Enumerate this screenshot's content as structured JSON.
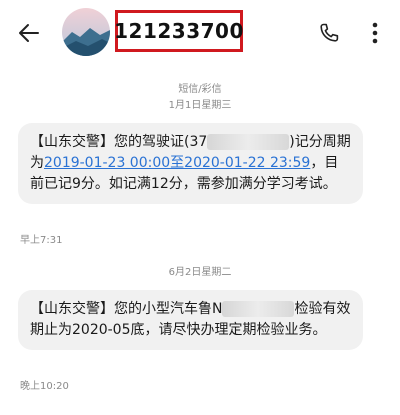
{
  "header": {
    "title": "121233700"
  },
  "thread": {
    "channel": "短信/彩信",
    "date_1": "1月1日星期三",
    "date_2": "6月2日星期二"
  },
  "messages": [
    {
      "sender_tag": "【山东交警】",
      "part_a": "您的驾驶证(",
      "redacted_prefix": "37",
      "part_b": ")记分周期为",
      "link_text": "2019-01-23 00:00至2020-01-22 23:59",
      "part_c": "，目前已记9分。如记满12分，需参加满分学习考试。",
      "time": "早上7:31"
    },
    {
      "sender_tag": "【山东交警】",
      "part_a": "您的小型汽车鲁N",
      "part_b": "检验有效期止为2020-05底，请尽快办理定期检验业务。",
      "time": "晚上10:20"
    }
  ],
  "colors": {
    "highlight_border": "#d0191f",
    "link": "#2a72d4",
    "bubble_bg": "#f1f1f1",
    "meta_text": "#8a8a8a"
  },
  "icons": [
    "back-arrow-icon",
    "avatar-landscape",
    "phone-icon",
    "more-vertical-icon"
  ]
}
